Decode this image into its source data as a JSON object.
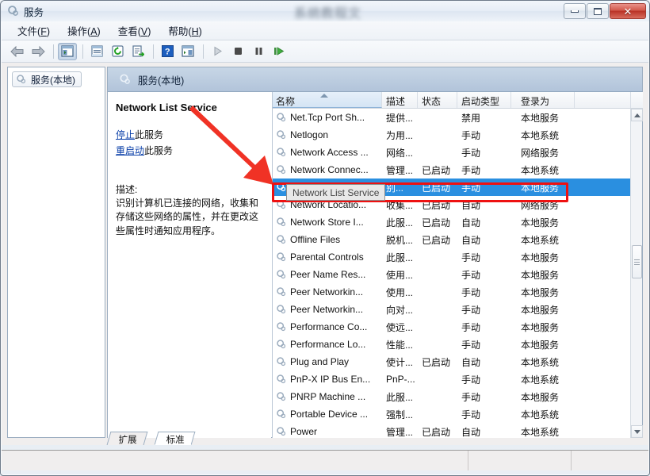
{
  "window": {
    "title": "服务",
    "icon": "services-gear-icon",
    "watermark": "系统教程文",
    "controls": {
      "minimize": "最小化",
      "maximize": "最大化",
      "close": "关闭"
    }
  },
  "menubar": [
    {
      "label": "文件",
      "accel": "F"
    },
    {
      "label": "操作",
      "accel": "A"
    },
    {
      "label": "查看",
      "accel": "V"
    },
    {
      "label": "帮助",
      "accel": "H"
    }
  ],
  "toolbar": [
    {
      "name": "back-icon",
      "label": "后退"
    },
    {
      "name": "forward-icon",
      "label": "前进"
    },
    {
      "name": "show-hide-tree-icon",
      "label": "显示/隐藏控制台树",
      "pressed": true
    },
    {
      "name": "properties-icon",
      "label": "属性"
    },
    {
      "name": "refresh-icon",
      "label": "刷新"
    },
    {
      "name": "export-list-icon",
      "label": "导出列表"
    },
    {
      "name": "help-icon",
      "label": "帮助"
    },
    {
      "name": "show-action-pane-icon",
      "label": "显示操作窗格"
    },
    {
      "name": "start-service-icon",
      "label": "启动服务"
    },
    {
      "name": "stop-service-icon",
      "label": "停止服务"
    },
    {
      "name": "pause-service-icon",
      "label": "暂停服务"
    },
    {
      "name": "restart-service-icon",
      "label": "重启动服务"
    }
  ],
  "tree": {
    "root_label": "服务(本地)",
    "icon": "services-gear-icon"
  },
  "pane_header": {
    "label": "服务(本地)",
    "icon": "services-gear-icon"
  },
  "details": {
    "service_name": "Network List Service",
    "stop_link": "停止",
    "stop_suffix": "此服务",
    "restart_link": "重启动",
    "restart_suffix": "此服务",
    "description_label": "描述:",
    "description_text": "识别计算机已连接的网络，收集和存储这些网络的属性，并在更改这些属性时通知应用程序。"
  },
  "list": {
    "columns": [
      {
        "key": "name",
        "label": "名称",
        "sorted": true,
        "sort_dir": "asc"
      },
      {
        "key": "description",
        "label": "描述"
      },
      {
        "key": "status",
        "label": "状态"
      },
      {
        "key": "startup",
        "label": "启动类型"
      },
      {
        "key": "logon",
        "label": "登录为"
      }
    ],
    "rows": [
      {
        "name": "Net.Tcp Port Sh...",
        "description": "提供...",
        "status": "",
        "startup": "禁用",
        "logon": "本地服务",
        "selected": false
      },
      {
        "name": "Netlogon",
        "description": "为用...",
        "status": "",
        "startup": "手动",
        "logon": "本地系统",
        "selected": false
      },
      {
        "name": "Network Access ...",
        "description": "网络...",
        "status": "",
        "startup": "手动",
        "logon": "网络服务",
        "selected": false
      },
      {
        "name": "Network Connec...",
        "description": "管理...",
        "status": "已启动",
        "startup": "手动",
        "logon": "本地系统",
        "selected": false
      },
      {
        "name": "Network List Ser...",
        "description": "别...",
        "status": "已启动",
        "startup": "手动",
        "logon": "本地服务",
        "selected": true
      },
      {
        "name": "Network Locatio...",
        "description": "收集...",
        "status": "已启动",
        "startup": "自动",
        "logon": "网络服务",
        "selected": false
      },
      {
        "name": "Network Store I...",
        "description": "此服...",
        "status": "已启动",
        "startup": "自动",
        "logon": "本地服务",
        "selected": false
      },
      {
        "name": "Offline Files",
        "description": "脱机...",
        "status": "已启动",
        "startup": "自动",
        "logon": "本地系统",
        "selected": false
      },
      {
        "name": "Parental Controls",
        "description": "此服...",
        "status": "",
        "startup": "手动",
        "logon": "本地服务",
        "selected": false
      },
      {
        "name": "Peer Name Res...",
        "description": "使用...",
        "status": "",
        "startup": "手动",
        "logon": "本地服务",
        "selected": false
      },
      {
        "name": "Peer Networkin...",
        "description": "使用...",
        "status": "",
        "startup": "手动",
        "logon": "本地服务",
        "selected": false
      },
      {
        "name": "Peer Networkin...",
        "description": "向对...",
        "status": "",
        "startup": "手动",
        "logon": "本地服务",
        "selected": false
      },
      {
        "name": "Performance Co...",
        "description": "使远...",
        "status": "",
        "startup": "手动",
        "logon": "本地服务",
        "selected": false
      },
      {
        "name": "Performance Lo...",
        "description": "性能...",
        "status": "",
        "startup": "手动",
        "logon": "本地服务",
        "selected": false
      },
      {
        "name": "Plug and Play",
        "description": "使计...",
        "status": "已启动",
        "startup": "自动",
        "logon": "本地系统",
        "selected": false
      },
      {
        "name": "PnP-X IP Bus En...",
        "description": "PnP-...",
        "status": "",
        "startup": "手动",
        "logon": "本地系统",
        "selected": false
      },
      {
        "name": "PNRP Machine ...",
        "description": "此服...",
        "status": "",
        "startup": "手动",
        "logon": "本地服务",
        "selected": false
      },
      {
        "name": "Portable Device ...",
        "description": "强制...",
        "status": "",
        "startup": "手动",
        "logon": "本地系统",
        "selected": false
      },
      {
        "name": "Power",
        "description": "管理...",
        "status": "已启动",
        "startup": "自动",
        "logon": "本地系统",
        "selected": false
      }
    ]
  },
  "tooltip": {
    "text": "Network List Service"
  },
  "tabs": [
    {
      "label": "扩展",
      "active": false
    },
    {
      "label": "标准",
      "active": true
    }
  ],
  "statusbar": {
    "text": ""
  },
  "annotations": {
    "arrow_color": "#f03225",
    "highlight_color": "#ee1111",
    "arrow_label": "red-pointer-arrow",
    "highlight_label": "selected-row-highlight"
  },
  "colors": {
    "selection_blue": "#2a8fe0",
    "header_blue": "#b2c4da",
    "link_blue": "#0a3fa8"
  }
}
